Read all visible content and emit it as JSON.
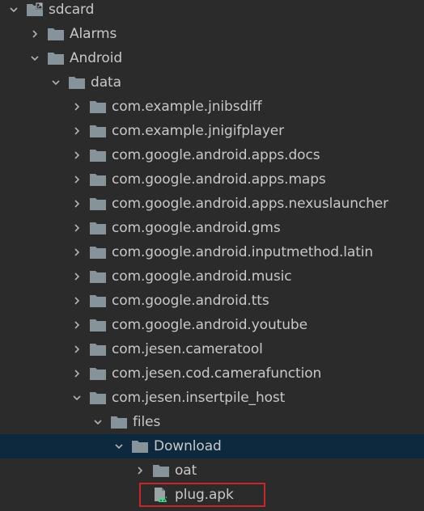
{
  "file_tree": {
    "items": [
      {
        "label": "sdcard",
        "icon": "sdcard-folder-icon",
        "state": "expanded",
        "depth": 0
      },
      {
        "label": "Alarms",
        "icon": "folder-icon",
        "state": "collapsed",
        "depth": 1
      },
      {
        "label": "Android",
        "icon": "folder-icon",
        "state": "expanded",
        "depth": 1
      },
      {
        "label": "data",
        "icon": "folder-icon",
        "state": "expanded",
        "depth": 2
      },
      {
        "label": "com.example.jnibsdiff",
        "icon": "folder-icon",
        "state": "collapsed",
        "depth": 3
      },
      {
        "label": "com.example.jnigifplayer",
        "icon": "folder-icon",
        "state": "collapsed",
        "depth": 3
      },
      {
        "label": "com.google.android.apps.docs",
        "icon": "folder-icon",
        "state": "collapsed",
        "depth": 3
      },
      {
        "label": "com.google.android.apps.maps",
        "icon": "folder-icon",
        "state": "collapsed",
        "depth": 3
      },
      {
        "label": "com.google.android.apps.nexuslauncher",
        "icon": "folder-icon",
        "state": "collapsed",
        "depth": 3
      },
      {
        "label": "com.google.android.gms",
        "icon": "folder-icon",
        "state": "collapsed",
        "depth": 3
      },
      {
        "label": "com.google.android.inputmethod.latin",
        "icon": "folder-icon",
        "state": "collapsed",
        "depth": 3
      },
      {
        "label": "com.google.android.music",
        "icon": "folder-icon",
        "state": "collapsed",
        "depth": 3
      },
      {
        "label": "com.google.android.tts",
        "icon": "folder-icon",
        "state": "collapsed",
        "depth": 3
      },
      {
        "label": "com.google.android.youtube",
        "icon": "folder-icon",
        "state": "collapsed",
        "depth": 3
      },
      {
        "label": "com.jesen.cameratool",
        "icon": "folder-icon",
        "state": "collapsed",
        "depth": 3
      },
      {
        "label": "com.jesen.cod.camerafunction",
        "icon": "folder-icon",
        "state": "collapsed",
        "depth": 3
      },
      {
        "label": "com.jesen.insertpile_host",
        "icon": "folder-icon",
        "state": "expanded",
        "depth": 3
      },
      {
        "label": "files",
        "icon": "folder-icon",
        "state": "expanded",
        "depth": 4
      },
      {
        "label": "Download",
        "icon": "folder-icon",
        "state": "expanded",
        "depth": 5,
        "selected": true
      },
      {
        "label": "oat",
        "icon": "folder-icon",
        "state": "collapsed",
        "depth": 6
      },
      {
        "label": "plug.apk",
        "icon": "android-apk-file-icon",
        "state": "leaf",
        "depth": 6,
        "highlighted": true
      }
    ]
  },
  "colors": {
    "background": "#2b2b2b",
    "text": "#c8c8c8",
    "folder": "#87939a",
    "selection": "#0d293e",
    "highlight_border": "#c5282a",
    "android_green": "#3ddc84"
  }
}
